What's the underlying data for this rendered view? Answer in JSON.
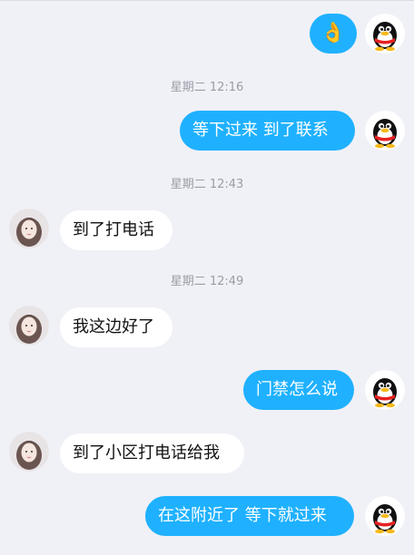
{
  "messages": [
    {
      "side": "out",
      "text": "👌"
    },
    {
      "side": "out",
      "text": "等下过来  到了联系"
    },
    {
      "side": "in",
      "text": "到了打电话"
    },
    {
      "side": "in",
      "text": "我这边好了"
    },
    {
      "side": "out",
      "text": "门禁怎么说"
    },
    {
      "side": "in",
      "text": "到了小区打电话给我"
    },
    {
      "side": "out",
      "text": "在这附近了  等下就过来"
    }
  ],
  "timestamps": [
    "星期二 12:16",
    "星期二 12:43",
    "星期二 12:49"
  ],
  "colors": {
    "background": "#f0f1f7",
    "outgoing_bubble": "#1fb1ff",
    "incoming_bubble": "#ffffff"
  },
  "icons": {
    "self_avatar": "qq-penguin-icon",
    "contact_avatar": "contact-photo"
  }
}
